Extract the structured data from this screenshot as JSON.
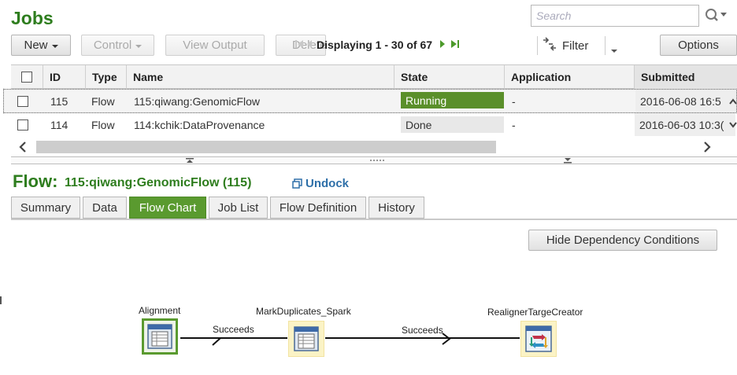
{
  "header": {
    "title": "Jobs",
    "search_placeholder": "Search"
  },
  "toolbar": {
    "new_label": "New",
    "control_label": "Control",
    "view_output_label": "View Output",
    "delete_label": "Delete",
    "paging_text": "Displaying 1 - 30 of 67",
    "filter_label": "Filter",
    "options_label": "Options"
  },
  "grid": {
    "columns": [
      "ID",
      "Type",
      "Name",
      "State",
      "Application",
      "Submitted"
    ],
    "rows": [
      {
        "id": "115",
        "type": "Flow",
        "name": "115:qiwang:GenomicFlow",
        "state": "Running",
        "application": "-",
        "submitted": "2016-06-08 16:5"
      },
      {
        "id": "114",
        "type": "Flow",
        "name": "114:kchik:DataProvenance",
        "state": "Done",
        "application": "-",
        "submitted": "2016-06-03 10:3("
      }
    ]
  },
  "detail": {
    "flow_label": "Flow:",
    "flow_name": "115:qiwang:GenomicFlow (115)",
    "undock_label": "Undock",
    "tabs": [
      "Summary",
      "Data",
      "Flow Chart",
      "Job List",
      "Flow Definition",
      "History"
    ],
    "active_tab": "Flow Chart",
    "hide_button_label": "Hide Dependency Conditions"
  },
  "flowchart": {
    "nodes": [
      {
        "label": "Alignment",
        "icon": "table-icon"
      },
      {
        "label": "MarkDuplicates_Spark",
        "icon": "table-icon"
      },
      {
        "label": "RealignerTargeCreator",
        "icon": "cycle-icon"
      }
    ],
    "edges": [
      {
        "label": "Succeeds"
      },
      {
        "label": "Succeeds"
      }
    ]
  },
  "colors": {
    "brand_green": "#2e7d1e",
    "running": "#5a8f2a",
    "active_tab": "#5a9a2f",
    "link_blue": "#2e6fa8"
  }
}
